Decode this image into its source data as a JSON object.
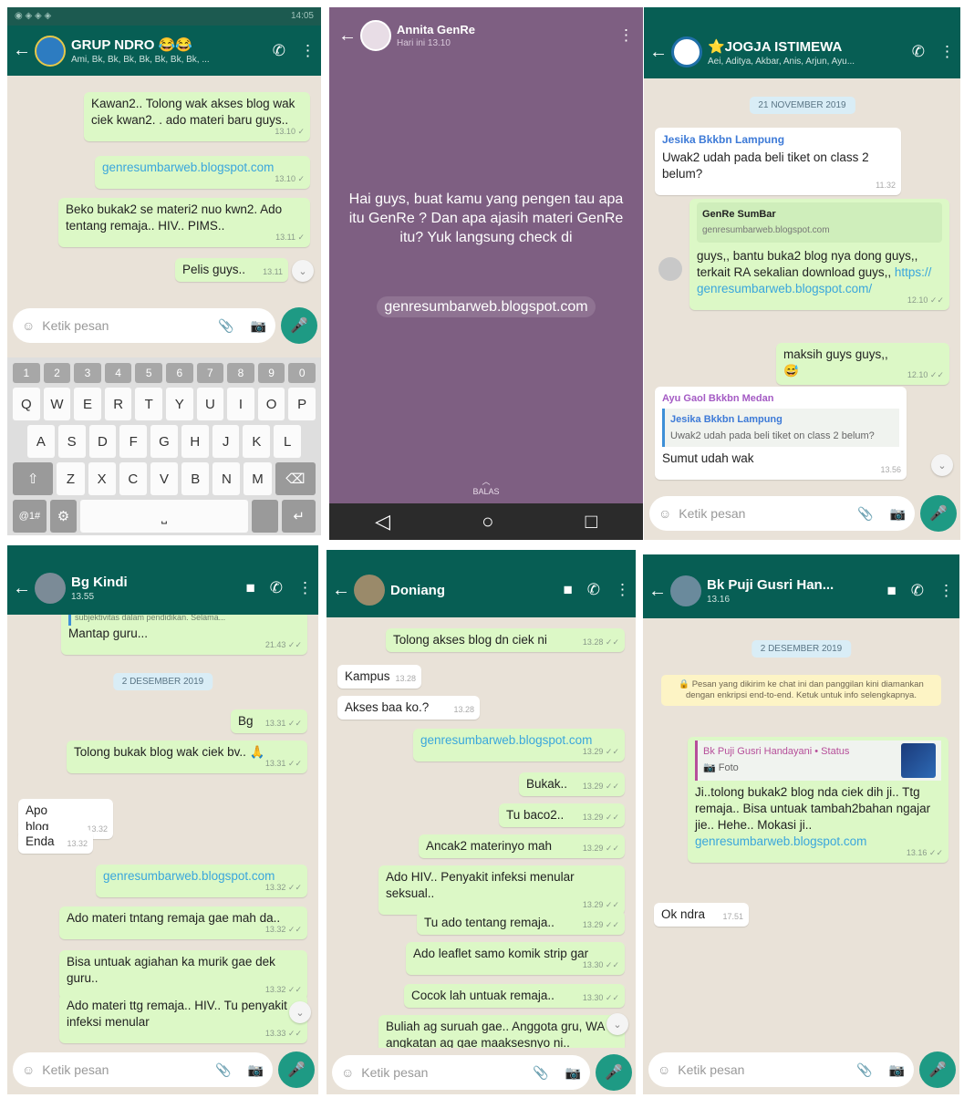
{
  "panel1": {
    "status_time": "14:05",
    "title": "GRUP NDRO 😂😂",
    "subtitle": "Ami, Bk, Bk, Bk, Bk, Bk, Bk, Bk, ...",
    "messages": [
      {
        "text": "Kawan2.. Tolong wak akses blog wak ciek kwan2. .  ado materi baru guys..",
        "time": "13.10 ✓"
      },
      {
        "text": "genresumbarweb.blogspot.com",
        "time": "13.10 ✓"
      },
      {
        "text": "Beko bukak2 se materi2 nuo kwn2. Ado tentang remaja.. HIV.. PIMS..",
        "time": "13.11 ✓"
      },
      {
        "text": "Pelis guys..",
        "time": "13.11"
      }
    ],
    "input_placeholder": "Ketik pesan",
    "keyboard": {
      "numbers": [
        "1",
        "2",
        "3",
        "4",
        "5",
        "6",
        "7",
        "8",
        "9",
        "0"
      ],
      "row1": [
        "Q",
        "W",
        "E",
        "R",
        "T",
        "Y",
        "U",
        "I",
        "O",
        "P"
      ],
      "row2": [
        "A",
        "S",
        "D",
        "F",
        "G",
        "H",
        "J",
        "K",
        "L"
      ],
      "row3": [
        "Z",
        "X",
        "C",
        "V",
        "B",
        "N",
        "M"
      ],
      "symbols_key": "@1#"
    }
  },
  "panel2": {
    "title": "Annita GenRe",
    "subtitle": "Hari ini 13.10",
    "status_text": "Hai guys, buat kamu yang pengen tau apa itu GenRe ? Dan apa ajasih materi GenRe itu? Yuk langsung check di",
    "link": "genresumbarweb.blogspot.com",
    "reply_label": "BALAS"
  },
  "panel3": {
    "title": "⭐JOGJA ISTIMEWA",
    "subtitle": "Aei, Aditya, Akbar, Anis, Arjun, Ayu...",
    "date": "21 NOVEMBER 2019",
    "msg1": {
      "sender": "Jesika Bkkbn Lampung",
      "text": "Uwak2 udah pada beli tiket on class 2 belum?",
      "time": "11.32"
    },
    "msg2": {
      "preview_title": "GenRe SumBar",
      "preview_url": "genresumbarweb.blogspot.com",
      "text": "guys,, bantu buka2 blog nya dong guys,, terkait RA sekalian download guys,, ",
      "link": "https:// genresumbarweb.blogspot.com/",
      "time": "12.10 ✓✓"
    },
    "msg3": {
      "text": "maksih guys guys,, 😅",
      "time": "12.10 ✓✓"
    },
    "msg4": {
      "sender": "Ayu Gaol Bkkbn Medan",
      "quote_sender": "Jesika Bkkbn Lampung",
      "quote_text": "Uwak2 udah pada beli tiket on class 2 belum?",
      "text": "Sumut udah wak",
      "time": "13.56"
    },
    "input_placeholder": "Ketik pesan"
  },
  "panel4": {
    "title": "Bg Kindi",
    "subtitle": "13.55",
    "top_cut": "subjektivitas dalam pendidikan. Selama...",
    "msg0": {
      "text": "Mantap guru...",
      "time": "21.43 ✓✓"
    },
    "date": "2 DESEMBER 2019",
    "msg1": {
      "text": "Bg",
      "time": "13.31 ✓✓"
    },
    "msg2": {
      "text": "Tolong bukak blog wak ciek bv.. 🙏",
      "time": "13.31 ✓✓"
    },
    "msg3": {
      "text": "Apo blog",
      "time": "13.32"
    },
    "msg4": {
      "text": "Enda",
      "time": "13.32"
    },
    "msg5": {
      "text": "genresumbarweb.blogspot.com",
      "time": "13.32 ✓✓"
    },
    "msg6": {
      "text": "Ado materi tntang remaja gae mah da..",
      "time": "13.32 ✓✓"
    },
    "msg7": {
      "text": "Bisa untuak agiahan ka murik gae dek guru..",
      "time": "13.32 ✓✓"
    },
    "msg8": {
      "text": "Ado materi ttg remaja.. HIV.. Tu penyakit infeksi menular",
      "time": "13.33 ✓✓"
    },
    "input_placeholder": "Ketik pesan"
  },
  "panel5": {
    "title": "Doniang",
    "msg0": {
      "text": "Tolong akses blog dn ciek ni",
      "time": "13.28 ✓✓"
    },
    "msg1": {
      "text": "Kampus",
      "time": "13.28"
    },
    "msg2": {
      "text": "Akses baa ko.?",
      "time": "13.28"
    },
    "msg3": {
      "text": "genresumbarweb.blogspot.com",
      "time": "13.29 ✓✓"
    },
    "msg4": {
      "text": "Bukak..",
      "time": "13.29 ✓✓"
    },
    "msg5": {
      "text": "Tu baco2..",
      "time": "13.29 ✓✓"
    },
    "msg6": {
      "text": "Ancak2 materinyo mah",
      "time": "13.29 ✓✓"
    },
    "msg7": {
      "text": "Ado HIV.. Penyakit infeksi menular seksual..",
      "time": "13.29 ✓✓"
    },
    "msg8": {
      "text": "Tu ado tentang remaja..",
      "time": "13.29 ✓✓"
    },
    "msg9": {
      "text": "Ado leaflet samo komik strip gar",
      "time": "13.30 ✓✓"
    },
    "msg10": {
      "text": "Cocok lah untuak remaja..",
      "time": "13.30 ✓✓"
    },
    "msg11": {
      "text": "Buliah ag suruah gae.. Anggota gru, WA angkatan ag gae maaksesnyo ni..",
      "time": ""
    },
    "input_placeholder": "Ketik pesan"
  },
  "panel6": {
    "title": "Bk Puji Gusri Han...",
    "subtitle": "13.16",
    "date": "2 DESEMBER 2019",
    "system_note": "🔒 Pesan yang dikirim ke chat ini dan panggilan kini diamankan dengan enkripsi end-to-end. Ketuk untuk info selengkapnya.",
    "msg1": {
      "quote_sender": "Bk Puji Gusri Handayani • Status",
      "quote_text": "📷 Foto",
      "text": "Ji..tolong bukak2 blog nda ciek dih ji.. Ttg remaja.. Bisa untuak tambah2bahan ngajar jie.. Hehe.. Mokasi ji..",
      "link": "genresumbarweb.blogspot.com",
      "time": "13.16 ✓✓"
    },
    "msg2": {
      "text": "Ok ndra",
      "time": "17.51"
    },
    "input_placeholder": "Ketik pesan"
  }
}
